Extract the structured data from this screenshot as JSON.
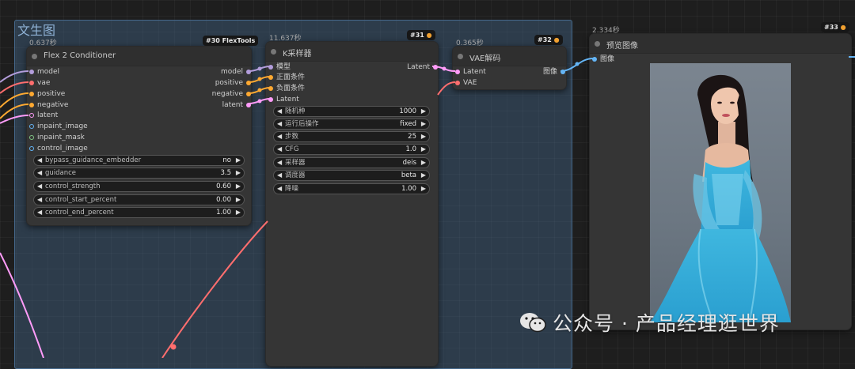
{
  "group": {
    "title": "文生图"
  },
  "nodes": {
    "n30": {
      "time": "0.637秒",
      "badge": "#30 FlexTools",
      "title": "Flex 2 Conditioner",
      "inputs": [
        "model",
        "vae",
        "positive",
        "negative",
        "latent",
        "inpaint_image",
        "inpaint_mask",
        "control_image"
      ],
      "outputs": [
        "model",
        "positive",
        "negative",
        "latent"
      ],
      "widgets": [
        {
          "name": "bypass_guidance_embedder",
          "value": "no"
        },
        {
          "name": "guidance",
          "value": "3.5"
        },
        {
          "name": "control_strength",
          "value": "0.60"
        },
        {
          "name": "control_start_percent",
          "value": "0.00"
        },
        {
          "name": "control_end_percent",
          "value": "1.00"
        }
      ]
    },
    "n31": {
      "time": "11.637秒",
      "badge": "#31",
      "title": "K采样器",
      "inputs": [
        "模型",
        "正面条件",
        "负面条件",
        "Latent"
      ],
      "outputs": [
        "Latent"
      ],
      "widgets": [
        {
          "name": "随机种",
          "value": "1000"
        },
        {
          "name": "运行后操作",
          "value": "fixed"
        },
        {
          "name": "步数",
          "value": "25"
        },
        {
          "name": "CFG",
          "value": "1.0"
        },
        {
          "name": "采样器",
          "value": "deis"
        },
        {
          "name": "调度器",
          "value": "beta"
        },
        {
          "name": "降噪",
          "value": "1.00"
        }
      ]
    },
    "n32": {
      "time": "0.365秒",
      "badge": "#32",
      "title": "VAE解码",
      "inputs": [
        "Latent",
        "VAE"
      ],
      "outputs": [
        "图像"
      ]
    },
    "n33": {
      "time": "2.334秒",
      "badge": "#33",
      "title": "预览图像",
      "inputs": [
        "图像"
      ]
    }
  },
  "slot_colors": {
    "model": "#b39ddb",
    "vae": "#ff6e6e",
    "conditioning": "#ffa931",
    "latent": "#ff9cf9",
    "image": "#64b5f6",
    "mask": "#81c784"
  },
  "watermark": {
    "text": "公众号 · 产品经理逛世界"
  },
  "icons": {
    "badge": "fox-icon",
    "watermark": "wechat-icon"
  }
}
